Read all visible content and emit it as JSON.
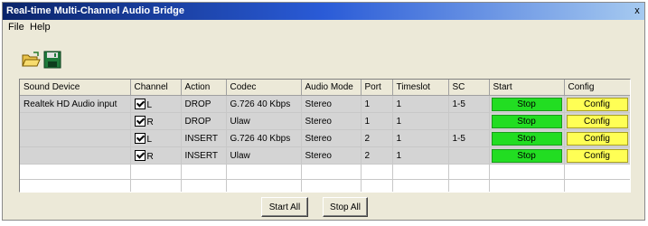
{
  "window": {
    "title": "Real-time Multi-Channel Audio Bridge",
    "close_label": "x"
  },
  "menu": [
    {
      "label": "File",
      "name": "menu-file"
    },
    {
      "label": "Help",
      "name": "menu-help"
    }
  ],
  "toolbar": [
    {
      "name": "open-folder-icon",
      "icon": "open-folder-icon"
    },
    {
      "name": "save-icon",
      "icon": "save-icon"
    }
  ],
  "colors": {
    "start_green": "#22dd22",
    "config_yellow": "#ffff55",
    "title_blue": "#0a246a"
  },
  "table": {
    "columns": [
      "Sound Device",
      "Channel",
      "Action",
      "Codec",
      "Audio Mode",
      "Port",
      "Timeslot",
      "SC",
      "Start",
      "Config"
    ],
    "rows": [
      {
        "device": "Realtek HD Audio input",
        "channel": "L",
        "checked": true,
        "action": "DROP",
        "codec": "G.726 40 Kbps",
        "mode": "Stereo",
        "port": "1",
        "timeslot": "1",
        "sc": "1-5",
        "start": "Stop",
        "config": "Config"
      },
      {
        "device": "",
        "channel": "R",
        "checked": true,
        "action": "DROP",
        "codec": "Ulaw",
        "mode": "Stereo",
        "port": "1",
        "timeslot": "1",
        "sc": "",
        "start": "Stop",
        "config": "Config"
      },
      {
        "device": "",
        "channel": "L",
        "checked": true,
        "action": "INSERT",
        "codec": "G.726 40 Kbps",
        "mode": "Stereo",
        "port": "2",
        "timeslot": "1",
        "sc": "1-5",
        "start": "Stop",
        "config": "Config"
      },
      {
        "device": "",
        "channel": "R",
        "checked": true,
        "action": "INSERT",
        "codec": "Ulaw",
        "mode": "Stereo",
        "port": "2",
        "timeslot": "1",
        "sc": "",
        "start": "Stop",
        "config": "Config"
      }
    ],
    "empty_rows": 2
  },
  "buttons": {
    "start_all": "Start All",
    "stop_all": "Stop All"
  }
}
